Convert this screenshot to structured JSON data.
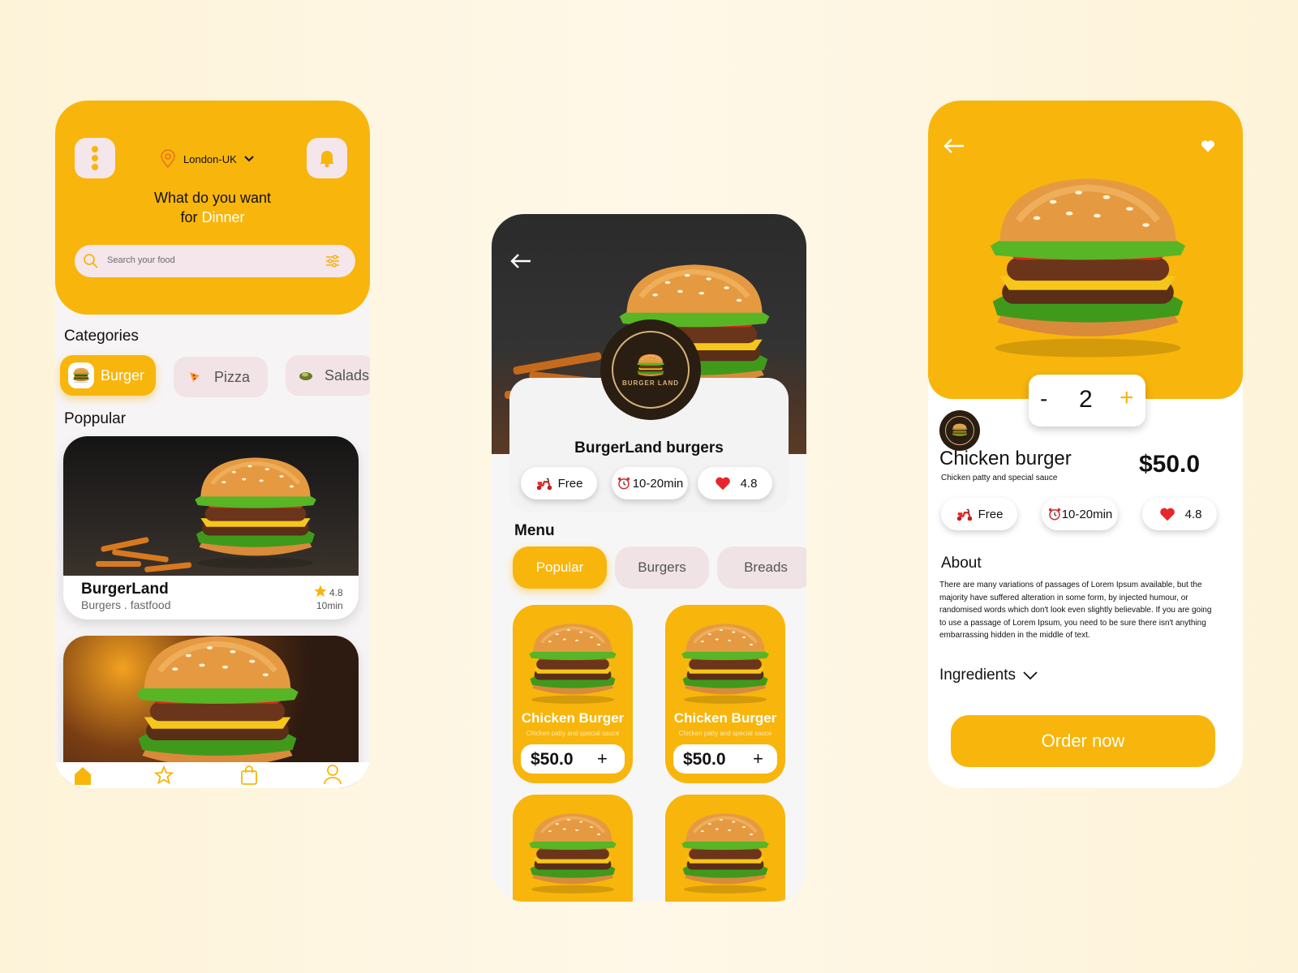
{
  "colors": {
    "accent": "#f8b50c",
    "chip_bg": "#f4e6ea",
    "heart": "#e8262c"
  },
  "home": {
    "location": "London-UK",
    "greeting_line1": "What do you want",
    "greeting_prefix": "for",
    "greeting_highlight": "Dinner",
    "search_placeholder": "Search your food",
    "categories_title": "Categories",
    "categories": [
      {
        "label": "Burger",
        "icon": "burger-icon",
        "active": true
      },
      {
        "label": "Pizza",
        "icon": "pizza-icon",
        "active": false
      },
      {
        "label": "Salads",
        "icon": "salad-icon",
        "active": false
      }
    ],
    "popular_title": "Poppular",
    "popular_card": {
      "name": "BurgerLand",
      "tags": "Burgers . fastfood",
      "rating": "4.8",
      "time": "10min"
    },
    "nav": [
      "home-icon",
      "star-icon",
      "bag-icon",
      "user-icon"
    ]
  },
  "restaurant": {
    "name": "BurgerLand burgers",
    "logo_text": "BURGER LAND",
    "delivery": "Free",
    "time": "10-20min",
    "rating": "4.8",
    "menu_title": "Menu",
    "tabs": [
      {
        "label": "Popular",
        "active": true
      },
      {
        "label": "Burgers",
        "active": false
      },
      {
        "label": "Breads",
        "active": false
      }
    ],
    "items": [
      {
        "name": "Chicken Burger",
        "desc": "Chicken patty and special sauce",
        "price": "$50.0",
        "add": "+"
      },
      {
        "name": "Chicken Burger",
        "desc": "Chicken patty and special sauce",
        "price": "$50.0",
        "add": "+"
      }
    ]
  },
  "detail": {
    "quantity": "2",
    "minus": "-",
    "plus": "+",
    "name": "Chicken burger",
    "subtitle": "Chicken patty and special sauce",
    "price": "$50.0",
    "delivery": "Free",
    "time": "10-20min",
    "rating": "4.8",
    "about_title": "About",
    "about_text": "There are many variations of passages of Lorem Ipsum available, but the majority have suffered alteration in some form, by injected humour, or randomised words which don't look even slightly believable. If you are going to use a passage of Lorem Ipsum, you need to be sure there isn't anything embarrassing hidden in the middle of text.",
    "ingredients_label": "Ingredients",
    "order_label": "Order now"
  }
}
